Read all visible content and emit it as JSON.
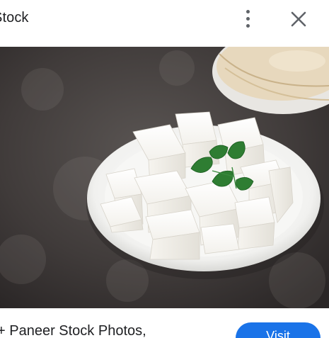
{
  "header": {
    "title": "Stock",
    "more_icon": "more-vert-icon",
    "close_icon": "close-icon"
  },
  "image": {
    "subject": "paneer-cubes-on-plate"
  },
  "footer": {
    "caption": "+ Paneer Stock Photos,",
    "visit_label": "Visit"
  },
  "colors": {
    "accent": "#1a73e8",
    "icon": "#5f6368",
    "text": "#202124"
  }
}
